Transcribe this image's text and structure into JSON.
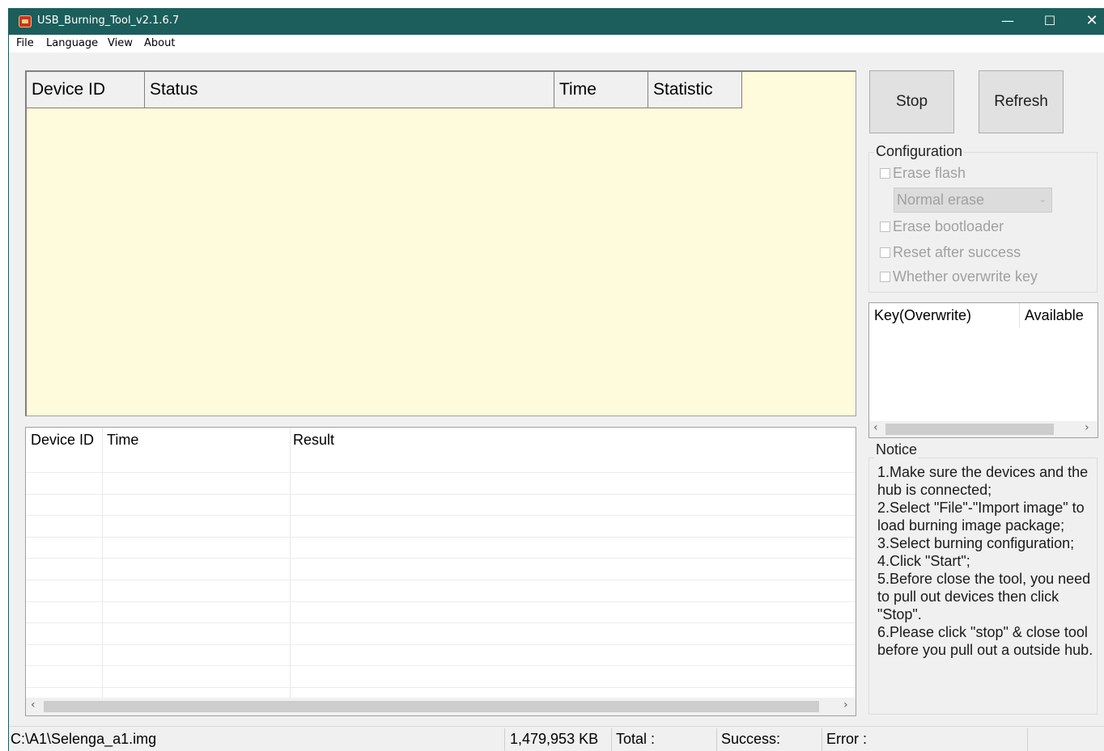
{
  "window": {
    "title": "USB_Burning_Tool_v2.1.6.7",
    "controls": {
      "minimize": "—",
      "maximize": "☐",
      "close": "✕"
    }
  },
  "menu": {
    "items": [
      "File",
      "Language",
      "View",
      "About"
    ]
  },
  "device_table": {
    "columns": [
      "Device ID",
      "Status",
      "Time",
      "Statistic"
    ],
    "rows": []
  },
  "result_table": {
    "columns": [
      "Device ID",
      "Time",
      "Result"
    ],
    "rows": []
  },
  "buttons": {
    "stop": "Stop",
    "refresh": "Refresh"
  },
  "configuration": {
    "title": "Configuration",
    "erase_flash": {
      "label": "Erase flash",
      "checked": false,
      "enabled": false
    },
    "erase_mode": {
      "value": "Normal erase",
      "enabled": false
    },
    "erase_bootloader": {
      "label": "Erase bootloader",
      "checked": false,
      "enabled": false
    },
    "reset_after_success": {
      "label": "Reset after success",
      "checked": false,
      "enabled": false
    },
    "overwrite_key": {
      "label": "Whether overwrite key",
      "checked": false,
      "enabled": false
    }
  },
  "key_table": {
    "columns": [
      "Key(Overwrite)",
      "Available"
    ]
  },
  "notice": {
    "title": "Notice",
    "lines": [
      "1.Make sure the devices and the hub is connected;",
      "2.Select \"File\"-\"Import image\" to load burning image package;",
      "3.Select burning configuration;",
      "4.Click \"Start\";",
      "5.Before close the tool, you need to pull out devices then click \"Stop\".",
      "6.Please click \"stop\" & close tool before you pull out a outside hub."
    ]
  },
  "status_bar": {
    "image_path": "C:\\A1\\Selenga_a1.img",
    "image_size": "1,479,953 KB",
    "total": "Total :",
    "success": "Success:",
    "error": "Error :"
  },
  "colors": {
    "titlebar": "#1b5e5c",
    "device_panel_bg": "#fefbdc"
  }
}
